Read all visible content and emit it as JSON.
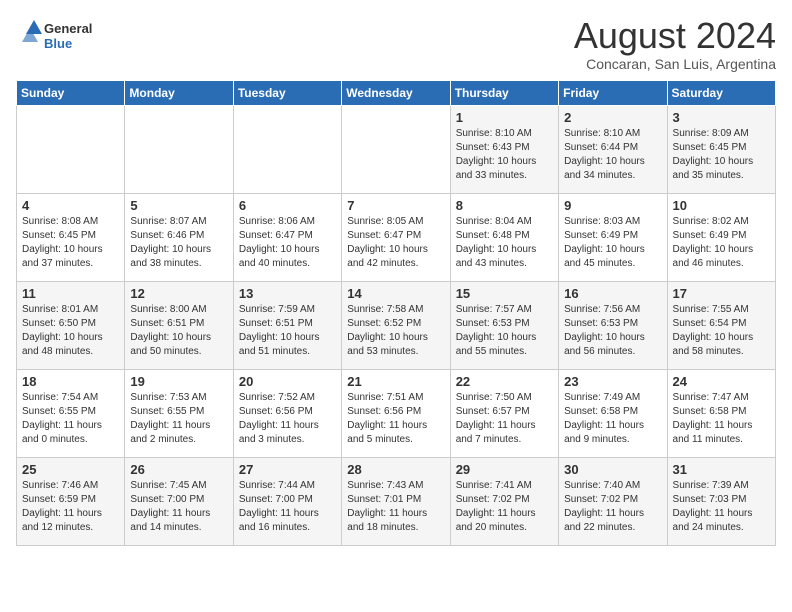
{
  "header": {
    "logo_general": "General",
    "logo_blue": "Blue",
    "month_year": "August 2024",
    "location": "Concaran, San Luis, Argentina"
  },
  "days_of_week": [
    "Sunday",
    "Monday",
    "Tuesday",
    "Wednesday",
    "Thursday",
    "Friday",
    "Saturday"
  ],
  "weeks": [
    [
      {
        "day": "",
        "content": ""
      },
      {
        "day": "",
        "content": ""
      },
      {
        "day": "",
        "content": ""
      },
      {
        "day": "",
        "content": ""
      },
      {
        "day": "1",
        "content": "Sunrise: 8:10 AM\nSunset: 6:43 PM\nDaylight: 10 hours\nand 33 minutes."
      },
      {
        "day": "2",
        "content": "Sunrise: 8:10 AM\nSunset: 6:44 PM\nDaylight: 10 hours\nand 34 minutes."
      },
      {
        "day": "3",
        "content": "Sunrise: 8:09 AM\nSunset: 6:45 PM\nDaylight: 10 hours\nand 35 minutes."
      }
    ],
    [
      {
        "day": "4",
        "content": "Sunrise: 8:08 AM\nSunset: 6:45 PM\nDaylight: 10 hours\nand 37 minutes."
      },
      {
        "day": "5",
        "content": "Sunrise: 8:07 AM\nSunset: 6:46 PM\nDaylight: 10 hours\nand 38 minutes."
      },
      {
        "day": "6",
        "content": "Sunrise: 8:06 AM\nSunset: 6:47 PM\nDaylight: 10 hours\nand 40 minutes."
      },
      {
        "day": "7",
        "content": "Sunrise: 8:05 AM\nSunset: 6:47 PM\nDaylight: 10 hours\nand 42 minutes."
      },
      {
        "day": "8",
        "content": "Sunrise: 8:04 AM\nSunset: 6:48 PM\nDaylight: 10 hours\nand 43 minutes."
      },
      {
        "day": "9",
        "content": "Sunrise: 8:03 AM\nSunset: 6:49 PM\nDaylight: 10 hours\nand 45 minutes."
      },
      {
        "day": "10",
        "content": "Sunrise: 8:02 AM\nSunset: 6:49 PM\nDaylight: 10 hours\nand 46 minutes."
      }
    ],
    [
      {
        "day": "11",
        "content": "Sunrise: 8:01 AM\nSunset: 6:50 PM\nDaylight: 10 hours\nand 48 minutes."
      },
      {
        "day": "12",
        "content": "Sunrise: 8:00 AM\nSunset: 6:51 PM\nDaylight: 10 hours\nand 50 minutes."
      },
      {
        "day": "13",
        "content": "Sunrise: 7:59 AM\nSunset: 6:51 PM\nDaylight: 10 hours\nand 51 minutes."
      },
      {
        "day": "14",
        "content": "Sunrise: 7:58 AM\nSunset: 6:52 PM\nDaylight: 10 hours\nand 53 minutes."
      },
      {
        "day": "15",
        "content": "Sunrise: 7:57 AM\nSunset: 6:53 PM\nDaylight: 10 hours\nand 55 minutes."
      },
      {
        "day": "16",
        "content": "Sunrise: 7:56 AM\nSunset: 6:53 PM\nDaylight: 10 hours\nand 56 minutes."
      },
      {
        "day": "17",
        "content": "Sunrise: 7:55 AM\nSunset: 6:54 PM\nDaylight: 10 hours\nand 58 minutes."
      }
    ],
    [
      {
        "day": "18",
        "content": "Sunrise: 7:54 AM\nSunset: 6:55 PM\nDaylight: 11 hours\nand 0 minutes."
      },
      {
        "day": "19",
        "content": "Sunrise: 7:53 AM\nSunset: 6:55 PM\nDaylight: 11 hours\nand 2 minutes."
      },
      {
        "day": "20",
        "content": "Sunrise: 7:52 AM\nSunset: 6:56 PM\nDaylight: 11 hours\nand 3 minutes."
      },
      {
        "day": "21",
        "content": "Sunrise: 7:51 AM\nSunset: 6:56 PM\nDaylight: 11 hours\nand 5 minutes."
      },
      {
        "day": "22",
        "content": "Sunrise: 7:50 AM\nSunset: 6:57 PM\nDaylight: 11 hours\nand 7 minutes."
      },
      {
        "day": "23",
        "content": "Sunrise: 7:49 AM\nSunset: 6:58 PM\nDaylight: 11 hours\nand 9 minutes."
      },
      {
        "day": "24",
        "content": "Sunrise: 7:47 AM\nSunset: 6:58 PM\nDaylight: 11 hours\nand 11 minutes."
      }
    ],
    [
      {
        "day": "25",
        "content": "Sunrise: 7:46 AM\nSunset: 6:59 PM\nDaylight: 11 hours\nand 12 minutes."
      },
      {
        "day": "26",
        "content": "Sunrise: 7:45 AM\nSunset: 7:00 PM\nDaylight: 11 hours\nand 14 minutes."
      },
      {
        "day": "27",
        "content": "Sunrise: 7:44 AM\nSunset: 7:00 PM\nDaylight: 11 hours\nand 16 minutes."
      },
      {
        "day": "28",
        "content": "Sunrise: 7:43 AM\nSunset: 7:01 PM\nDaylight: 11 hours\nand 18 minutes."
      },
      {
        "day": "29",
        "content": "Sunrise: 7:41 AM\nSunset: 7:02 PM\nDaylight: 11 hours\nand 20 minutes."
      },
      {
        "day": "30",
        "content": "Sunrise: 7:40 AM\nSunset: 7:02 PM\nDaylight: 11 hours\nand 22 minutes."
      },
      {
        "day": "31",
        "content": "Sunrise: 7:39 AM\nSunset: 7:03 PM\nDaylight: 11 hours\nand 24 minutes."
      }
    ]
  ]
}
